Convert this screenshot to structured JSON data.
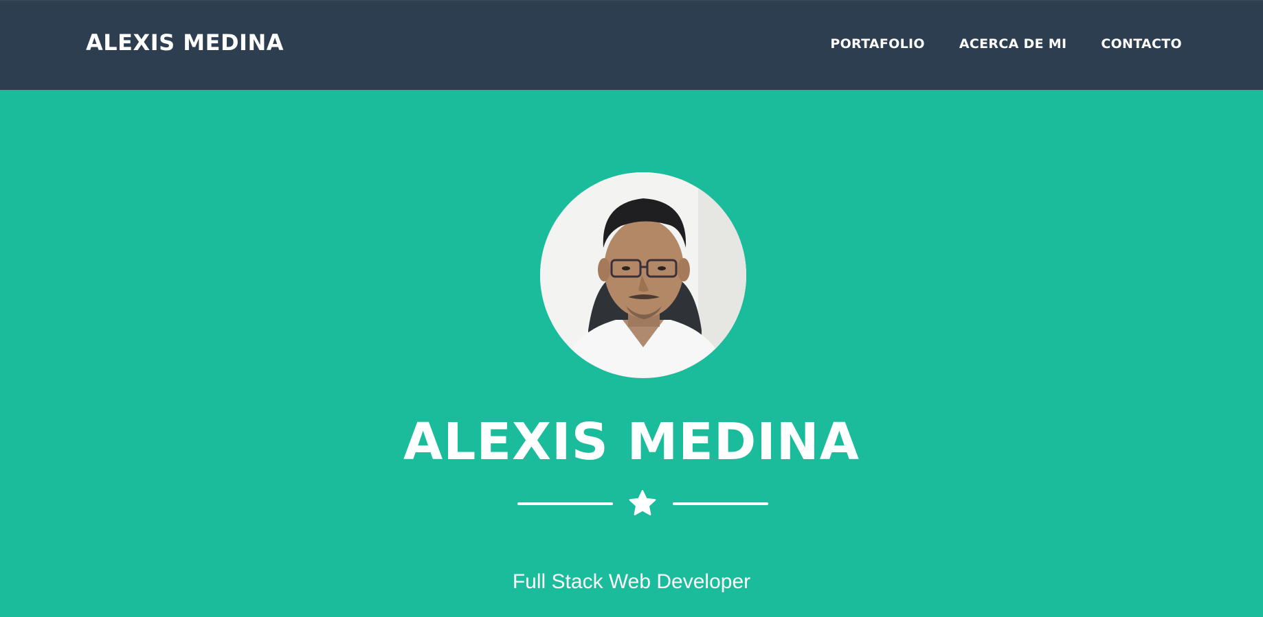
{
  "navbar": {
    "brand": "ALEXIS MEDINA",
    "links": [
      {
        "label": "PORTAFOLIO"
      },
      {
        "label": "ACERCA DE MI"
      },
      {
        "label": "CONTACTO"
      }
    ]
  },
  "masthead": {
    "title": "ALEXIS MEDINA",
    "subtitle": "Full Stack Web Developer",
    "divider_icon": "star-icon"
  },
  "colors": {
    "navbar_bg": "#2c3e50",
    "hero_bg": "#1abc9c",
    "text": "#ffffff"
  }
}
